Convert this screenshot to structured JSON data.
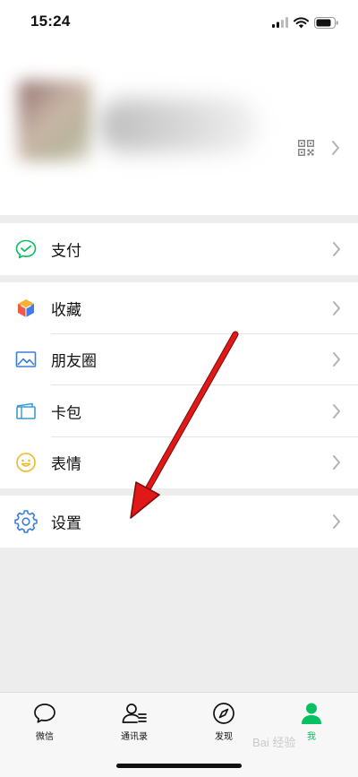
{
  "status_bar": {
    "time": "15:24"
  },
  "profile": {},
  "menu": {
    "group1": [
      {
        "label": "支付",
        "icon": "wechat-pay-icon"
      }
    ],
    "group2": [
      {
        "label": "收藏",
        "icon": "favorites-cube-icon"
      },
      {
        "label": "朋友圈",
        "icon": "moments-picture-icon"
      },
      {
        "label": "卡包",
        "icon": "card-wallet-icon"
      },
      {
        "label": "表情",
        "icon": "smiley-sticker-icon"
      }
    ],
    "group3": [
      {
        "label": "设置",
        "icon": "gear-icon"
      }
    ]
  },
  "tab_bar": {
    "tabs": [
      {
        "label": "微信",
        "icon": "chat-bubble-icon"
      },
      {
        "label": "通讯录",
        "icon": "contacts-icon"
      },
      {
        "label": "发现",
        "icon": "compass-icon"
      },
      {
        "label": "我",
        "icon": "person-icon",
        "active": true
      }
    ]
  },
  "colors": {
    "accent": "#07c160",
    "annotation_arrow": "#e01818",
    "background": "#ededed"
  },
  "watermark": "Bai 经验"
}
